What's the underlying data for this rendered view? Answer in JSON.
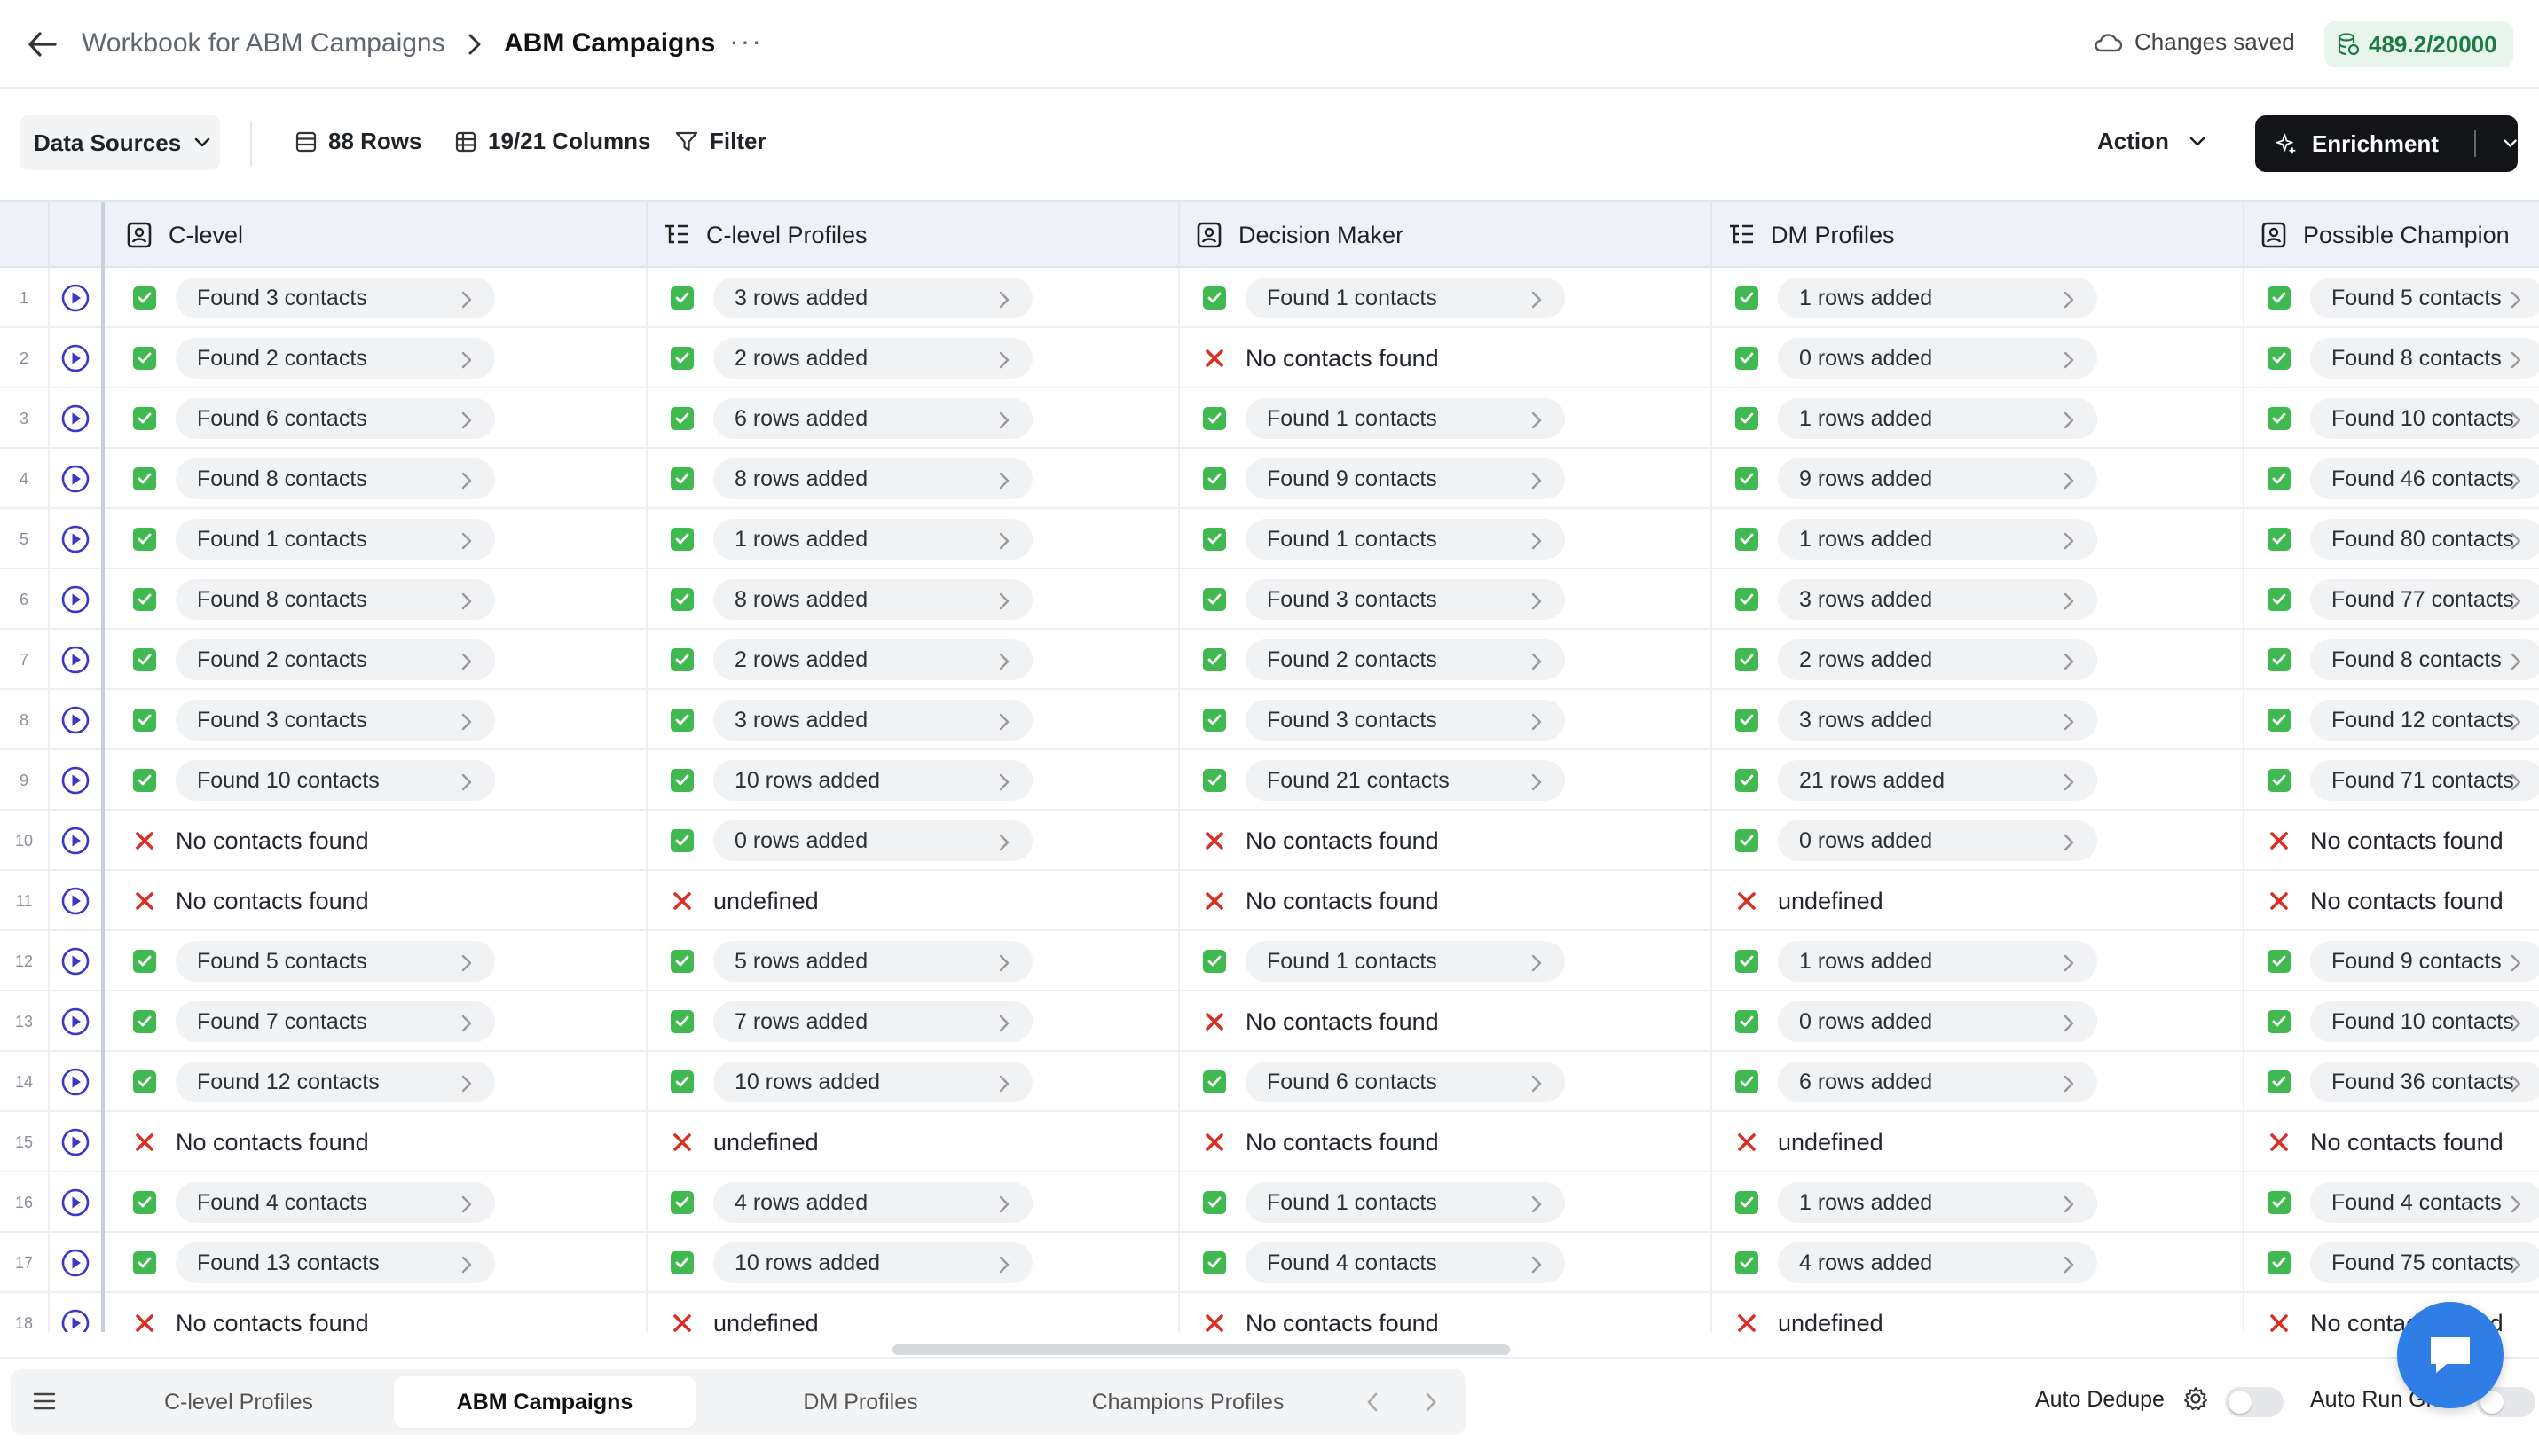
{
  "topbar": {
    "workbook": "Workbook for ABM Campaigns",
    "current": "ABM Campaigns",
    "more": "···",
    "saved": "Changes saved",
    "credits": "489.2/20000"
  },
  "toolbar": {
    "data_sources": "Data Sources",
    "rows": "88 Rows",
    "columns": "19/21 Columns",
    "filter": "Filter",
    "action": "Action",
    "enrichment": "Enrichment"
  },
  "columns": [
    "C-level",
    "C-level Profiles",
    "Decision Maker",
    "DM Profiles",
    "Possible Champion"
  ],
  "rows": [
    {
      "n": "1",
      "c": [
        "ok",
        "Found 3 contacts",
        "ok",
        "3 rows added",
        "ok",
        "Found 1 contacts",
        "ok",
        "1 rows added",
        "ok",
        "Found 5 contacts"
      ]
    },
    {
      "n": "2",
      "c": [
        "ok",
        "Found 2 contacts",
        "ok",
        "2 rows added",
        "x",
        "No contacts found",
        "ok",
        "0 rows added",
        "ok",
        "Found 8 contacts"
      ]
    },
    {
      "n": "3",
      "c": [
        "ok",
        "Found 6 contacts",
        "ok",
        "6 rows added",
        "ok",
        "Found 1 contacts",
        "ok",
        "1 rows added",
        "ok",
        "Found 10 contacts"
      ]
    },
    {
      "n": "4",
      "c": [
        "ok",
        "Found 8 contacts",
        "ok",
        "8 rows added",
        "ok",
        "Found 9 contacts",
        "ok",
        "9 rows added",
        "ok",
        "Found 46 contacts"
      ]
    },
    {
      "n": "5",
      "c": [
        "ok",
        "Found 1 contacts",
        "ok",
        "1 rows added",
        "ok",
        "Found 1 contacts",
        "ok",
        "1 rows added",
        "ok",
        "Found 80 contacts"
      ]
    },
    {
      "n": "6",
      "c": [
        "ok",
        "Found 8 contacts",
        "ok",
        "8 rows added",
        "ok",
        "Found 3 contacts",
        "ok",
        "3 rows added",
        "ok",
        "Found 77 contacts"
      ]
    },
    {
      "n": "7",
      "c": [
        "ok",
        "Found 2 contacts",
        "ok",
        "2 rows added",
        "ok",
        "Found 2 contacts",
        "ok",
        "2 rows added",
        "ok",
        "Found 8 contacts"
      ]
    },
    {
      "n": "8",
      "c": [
        "ok",
        "Found 3 contacts",
        "ok",
        "3 rows added",
        "ok",
        "Found 3 contacts",
        "ok",
        "3 rows added",
        "ok",
        "Found 12 contacts"
      ]
    },
    {
      "n": "9",
      "c": [
        "ok",
        "Found 10 contacts",
        "ok",
        "10 rows added",
        "ok",
        "Found 21 contacts",
        "ok",
        "21 rows added",
        "ok",
        "Found 71 contacts"
      ]
    },
    {
      "n": "10",
      "c": [
        "x",
        "No contacts found",
        "ok",
        "0 rows added",
        "x",
        "No contacts found",
        "ok",
        "0 rows added",
        "x",
        "No contacts found"
      ]
    },
    {
      "n": "11",
      "c": [
        "x",
        "No contacts found",
        "x",
        "undefined",
        "x",
        "No contacts found",
        "x",
        "undefined",
        "x",
        "No contacts found"
      ]
    },
    {
      "n": "12",
      "c": [
        "ok",
        "Found 5 contacts",
        "ok",
        "5 rows added",
        "ok",
        "Found 1 contacts",
        "ok",
        "1 rows added",
        "ok",
        "Found 9 contacts"
      ]
    },
    {
      "n": "13",
      "c": [
        "ok",
        "Found 7 contacts",
        "ok",
        "7 rows added",
        "x",
        "No contacts found",
        "ok",
        "0 rows added",
        "ok",
        "Found 10 contacts"
      ]
    },
    {
      "n": "14",
      "c": [
        "ok",
        "Found 12 contacts",
        "ok",
        "10 rows added",
        "ok",
        "Found 6 contacts",
        "ok",
        "6 rows added",
        "ok",
        "Found 36 contacts"
      ]
    },
    {
      "n": "15",
      "c": [
        "x",
        "No contacts found",
        "x",
        "undefined",
        "x",
        "No contacts found",
        "x",
        "undefined",
        "x",
        "No contacts found"
      ]
    },
    {
      "n": "16",
      "c": [
        "ok",
        "Found 4 contacts",
        "ok",
        "4 rows added",
        "ok",
        "Found 1 contacts",
        "ok",
        "1 rows added",
        "ok",
        "Found 4 contacts"
      ]
    },
    {
      "n": "17",
      "c": [
        "ok",
        "Found 13 contacts",
        "ok",
        "10 rows added",
        "ok",
        "Found 4 contacts",
        "ok",
        "4 rows added",
        "ok",
        "Found 75 contacts"
      ]
    },
    {
      "n": "18",
      "c": [
        "x",
        "No contacts found",
        "x",
        "undefined",
        "x",
        "No contacts found",
        "x",
        "undefined",
        "x",
        "No contacts found"
      ]
    }
  ],
  "bottom": {
    "tabs": [
      "C-level Profiles",
      "ABM Campaigns",
      "DM Profiles",
      "Champions Profiles"
    ],
    "active_tab": "ABM Campaigns",
    "auto_dedupe": "Auto Dedupe",
    "auto_run": "Auto Run Grid"
  },
  "colors": {
    "accent": "#2f7ee6",
    "check_green": "#3fb950",
    "cross_red": "#d93025",
    "button_dark": "#121417"
  }
}
